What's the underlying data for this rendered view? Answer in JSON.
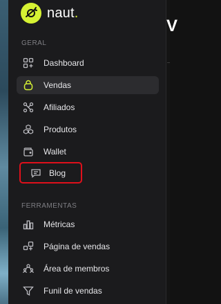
{
  "brand": {
    "name": "naut",
    "dot": "."
  },
  "sections": [
    {
      "label": "GERAL"
    },
    {
      "label": "FERRAMENTAS"
    }
  ],
  "nav_geral": [
    {
      "label": "Dashboard",
      "icon": "dashboard-icon"
    },
    {
      "label": "Vendas",
      "icon": "bag-icon",
      "active": true
    },
    {
      "label": "Afiliados",
      "icon": "affiliates-icon"
    },
    {
      "label": "Produtos",
      "icon": "products-icon"
    },
    {
      "label": "Wallet",
      "icon": "wallet-icon"
    },
    {
      "label": "Blog",
      "icon": "blog-icon",
      "highlighted": true
    }
  ],
  "nav_ferramentas": [
    {
      "label": "Métricas",
      "icon": "metrics-icon"
    },
    {
      "label": "Página de vendas",
      "icon": "sales-page-icon"
    },
    {
      "label": "Área de membros",
      "icon": "members-icon"
    },
    {
      "label": "Funil de vendas",
      "icon": "funnel-icon"
    }
  ],
  "right_panel": {
    "visible_char": "V"
  },
  "colors": {
    "accent": "#d6f233",
    "highlight": "#e0101b",
    "sidebar": "#1b1b1d",
    "active_item": "#2c2c2f"
  }
}
